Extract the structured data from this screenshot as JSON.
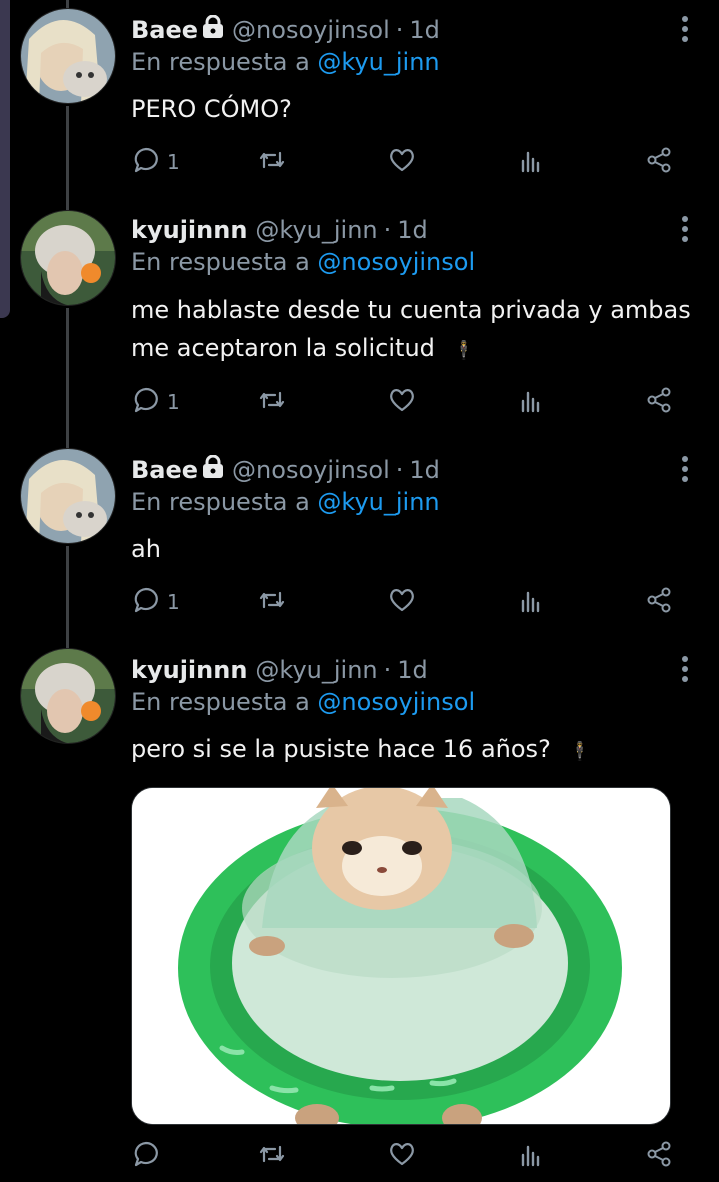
{
  "tweets": [
    {
      "name": "Baee",
      "locked": true,
      "handle": "@nosoyjinsol",
      "time": "1d",
      "reply_prefix": "En respuesta a",
      "reply_to": "@kyu_jinn",
      "text": "PERO CÓMO?",
      "replies": "1"
    },
    {
      "name": "kyujinnn",
      "locked": false,
      "handle": "@kyu_jinn",
      "time": "1d",
      "reply_prefix": "En respuesta a",
      "reply_to": "@nosoyjinsol",
      "text": "me hablaste desde tu cuenta privada y ambas me aceptaron la solicitud",
      "emoji": "🕴",
      "replies": "1"
    },
    {
      "name": "Baee",
      "locked": true,
      "handle": "@nosoyjinsol",
      "time": "1d",
      "reply_prefix": "En respuesta a",
      "reply_to": "@kyu_jinn",
      "text": "ah",
      "replies": "1"
    },
    {
      "name": "kyujinnn",
      "locked": false,
      "handle": "@kyu_jinn",
      "time": "1d",
      "reply_prefix": "En respuesta a",
      "reply_to": "@nosoyjinsol",
      "text": "pero si se la pusiste hace 16 años?",
      "emoji": "🕴",
      "replies": ""
    }
  ],
  "colors": {
    "background": "#000000",
    "link": "#1d9bf0",
    "muted": "#8b98a5",
    "thread_line": "#3e4144"
  },
  "icons": [
    "reply-icon",
    "retweet-icon",
    "like-icon",
    "analytics-icon",
    "share-icon",
    "lock-icon",
    "more-icon"
  ]
}
